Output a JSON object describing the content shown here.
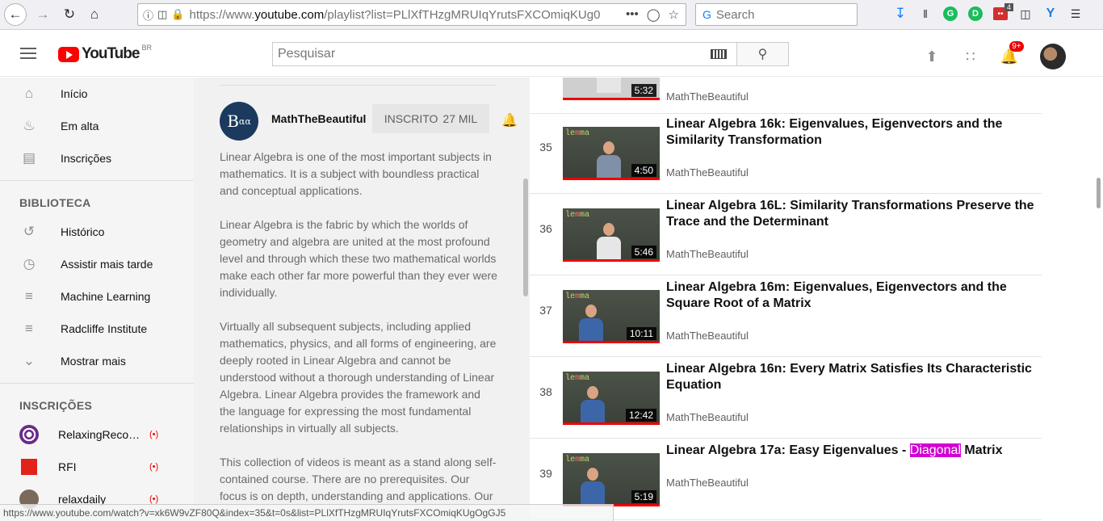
{
  "browser": {
    "url_prefix": "https://www.",
    "url_domain": "youtube.com",
    "url_rest": "/playlist?list=PLlXfTHzgMRUIqYrutsFXCOmiqKUg0",
    "search_placeholder": "Search",
    "ext_badge_count": "4"
  },
  "header": {
    "logo_text": "YouTube",
    "country_code": "BR",
    "search_placeholder": "Pesquisar",
    "notif_count": "9+"
  },
  "sidebar": {
    "main": [
      {
        "label": "Início",
        "icon": "home-icon"
      },
      {
        "label": "Em alta",
        "icon": "flame-icon"
      },
      {
        "label": "Inscrições",
        "icon": "subscriptions-icon"
      }
    ],
    "library_heading": "BIBLIOTECA",
    "library": [
      {
        "label": "Histórico",
        "icon": "history-icon"
      },
      {
        "label": "Assistir mais tarde",
        "icon": "clock-icon"
      },
      {
        "label": "Machine Learning",
        "icon": "playlist-icon"
      },
      {
        "label": "Radcliffe Institute",
        "icon": "playlist-icon"
      },
      {
        "label": "Mostrar mais",
        "icon": "chevron-down-icon"
      }
    ],
    "subs_heading": "INSCRIÇÕES",
    "subs": [
      {
        "label": "RelaxingRecordings",
        "color": "#6a2a8c"
      },
      {
        "label": "RFI",
        "color": "#e2231a"
      },
      {
        "label": "relaxdaily",
        "color": "#7a6a5a"
      }
    ]
  },
  "panel": {
    "channel_name": "MathTheBeautiful",
    "subscribe_label": "INSCRITO",
    "subscriber_count": "27 MIL",
    "description": [
      "Linear Algebra is one of the most important subjects in mathematics. It is a subject with boundless practical and conceptual applications.",
      "Linear Algebra is the fabric by which the worlds of geometry and algebra are united at the most profound level and through which these two mathematical worlds make each other far more powerful than they ever were individually.",
      "Virtually all subsequent subjects, including applied mathematics, physics, and all forms of engineering, are deeply rooted in Linear Algebra and cannot be understood without a thorough understanding of Linear Algebra. Linear Algebra provides the framework and the language for expressing the most fundamental relationships in virtually all subjects.",
      "This collection of videos is meant as a stand along self-contained course. There are no prerequisites. Our focus is on depth, understanding and applications. Our"
    ]
  },
  "videos": [
    {
      "index": "",
      "title": "",
      "channel": "MathTheBeautiful",
      "duration": "5:32",
      "person": "white"
    },
    {
      "index": "35",
      "title": "Linear Algebra 16k: Eigenvalues, Eigenvectors and the Similarity Transformation",
      "channel": "MathTheBeautiful",
      "duration": "4:50",
      "person": "grey"
    },
    {
      "index": "36",
      "title": "Linear Algebra 16L: Similarity Transformations Preserve the Trace and the Determinant",
      "channel": "MathTheBeautiful",
      "duration": "5:46",
      "person": "white"
    },
    {
      "index": "37",
      "title": "Linear Algebra 16m: Eigenvalues, Eigenvectors and the Square Root of a Matrix",
      "channel": "MathTheBeautiful",
      "duration": "10:11",
      "person": "blue"
    },
    {
      "index": "38",
      "title": "Linear Algebra 16n: Every Matrix Satisfies Its Characteristic Equation",
      "channel": "MathTheBeautiful",
      "duration": "12:42",
      "person": "blue"
    },
    {
      "index": "39",
      "title_before": "Linear Algebra 17a: Easy Eigenvalues - ",
      "title_highlight": "Diagonal",
      "title_after": " Matrix",
      "channel": "MathTheBeautiful",
      "duration": "5:19",
      "person": "blue"
    }
  ],
  "status_url": "https://www.youtube.com/watch?v=xk6W9vZF80Q&index=35&t=0s&list=PLlXfTHzgMRUIqYrutsFXCOmiqKUgOgGJ5"
}
